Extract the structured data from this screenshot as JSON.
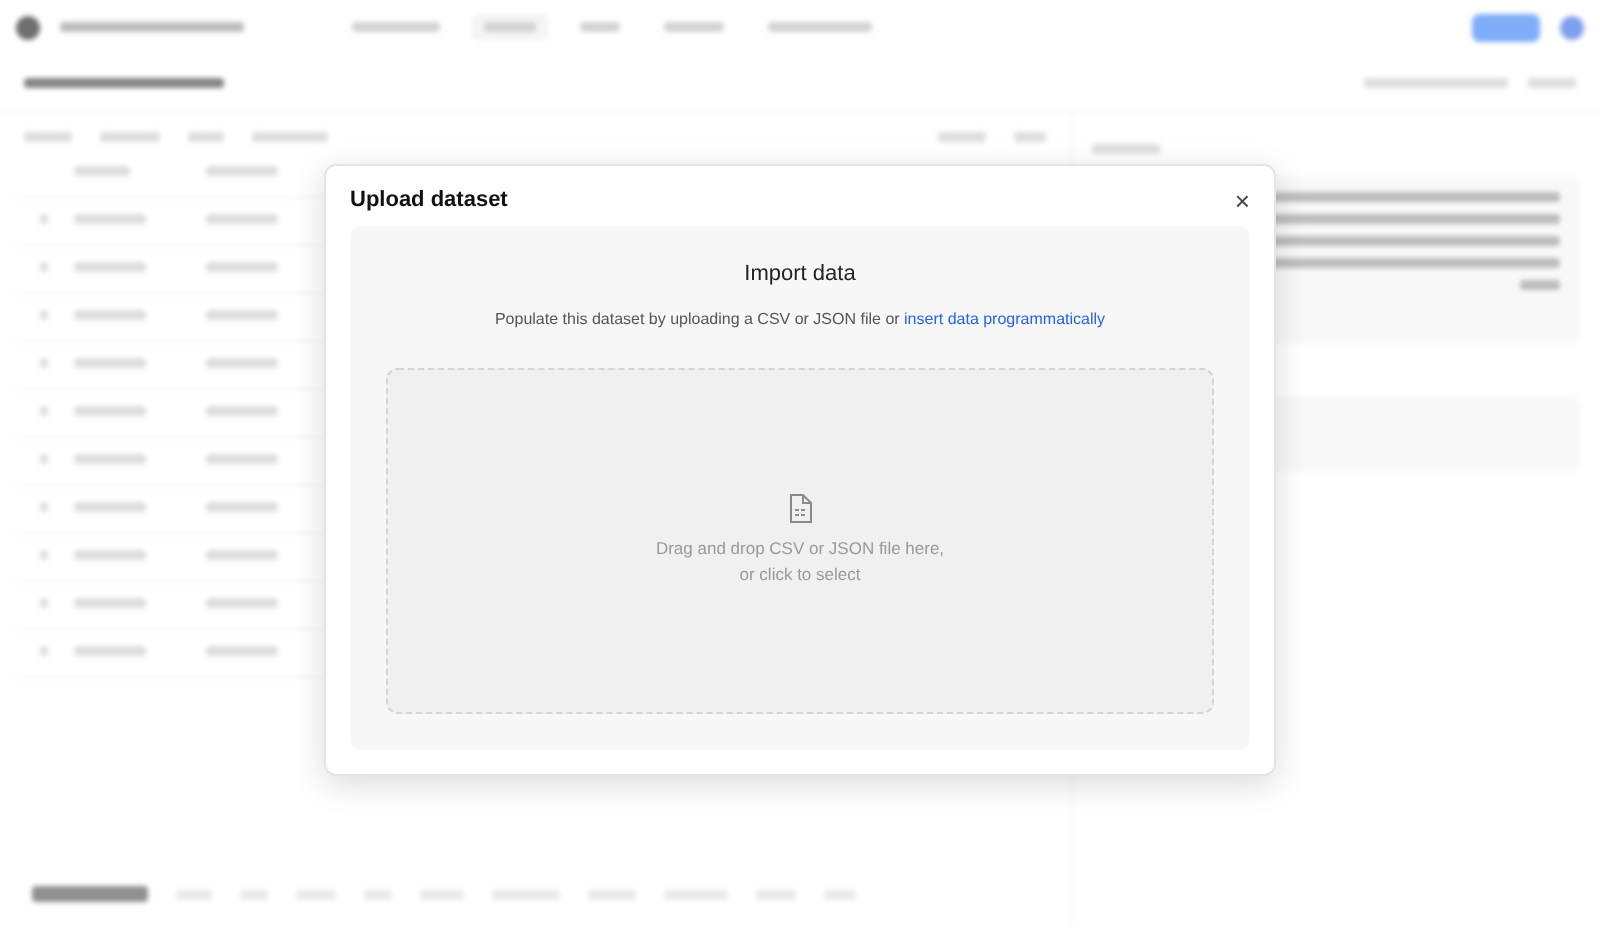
{
  "app": {
    "nav": [
      {
        "selected": false
      },
      {
        "selected": true
      },
      {
        "selected": false
      },
      {
        "selected": false
      },
      {
        "selected": false
      }
    ]
  },
  "dialog": {
    "title": "Upload dataset",
    "close": "×",
    "heading": "Import data",
    "intro": "Populate this dataset by uploading a CSV or JSON file or",
    "link": "insert data programmatically",
    "drop_line_1": "Drag and drop CSV or JSON file here,",
    "drop_line_2": "or click to select"
  }
}
